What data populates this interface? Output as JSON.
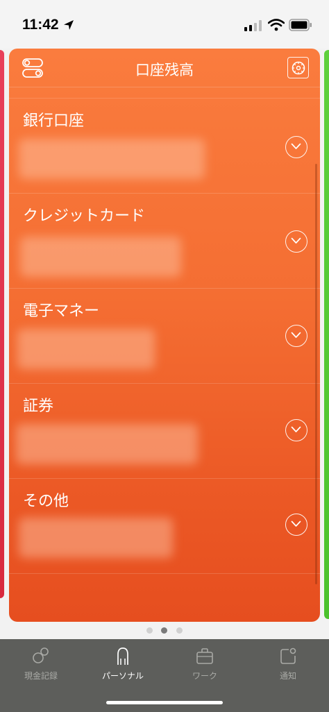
{
  "status_bar": {
    "time": "11:42"
  },
  "card": {
    "title": "口座残高",
    "sections": [
      {
        "title": "銀行口座"
      },
      {
        "title": "クレジットカード"
      },
      {
        "title": "電子マネー"
      },
      {
        "title": "証券"
      },
      {
        "title": "その他"
      }
    ]
  },
  "pager": {
    "count": 3,
    "active_index": 1
  },
  "tab_bar": {
    "tabs": [
      {
        "label": "現金記録",
        "icon": "cash-record-icon"
      },
      {
        "label": "パーソナル",
        "icon": "person-icon",
        "active": true
      },
      {
        "label": "ワーク",
        "icon": "briefcase-icon"
      },
      {
        "label": "通知",
        "icon": "notification-icon"
      }
    ]
  },
  "colors": {
    "card_top": "#fa7c3e",
    "card_bottom": "#e64e1f",
    "tab_bar": "#5d5e5b",
    "left_peek": "#e8405a",
    "right_peek": "#5ed03c"
  }
}
